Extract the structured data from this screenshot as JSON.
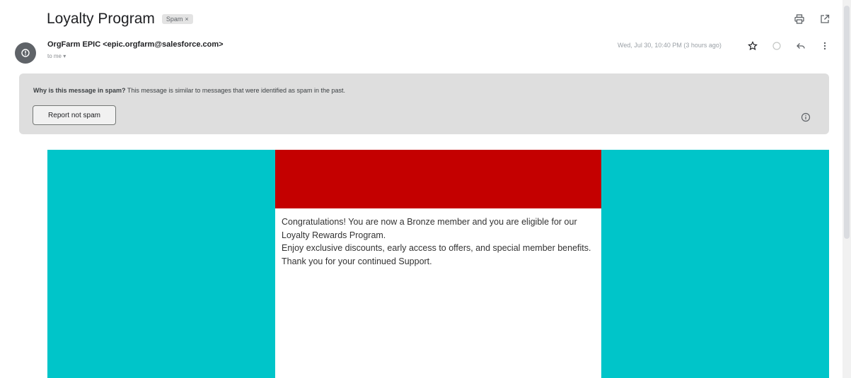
{
  "header": {
    "subject": "Loyalty Program",
    "label_chip": "Spam",
    "label_chip_remove": "×"
  },
  "message": {
    "sender_name": "OrgFarm EPIC",
    "sender_email": "<epic.orgfarm@salesforce.com>",
    "recipient": "to me",
    "date": "Wed, Jul 30, 10:40 PM (3 hours ago)"
  },
  "spam_notice": {
    "reason_bold": "Why is this message in spam?",
    "reason_text": " This message is similar to messages that were identified as spam in the past.",
    "report_button": "Report not spam"
  },
  "email_content": {
    "line1": "Congratulations! You are now a Bronze member and you are eligible for our Loyalty Rewards Program.",
    "line2": "Enjoy exclusive discounts, early access to offers, and special member benefits.",
    "line3": "Thank you for your continued Support."
  },
  "colors": {
    "accent_teal": "#00c5c9",
    "banner_red": "#c40000"
  },
  "icons": [
    "print-icon",
    "open-new-window-icon",
    "star-icon",
    "emoji-icon",
    "reply-icon",
    "more-vert-icon",
    "info-icon",
    "avatar-icon"
  ]
}
